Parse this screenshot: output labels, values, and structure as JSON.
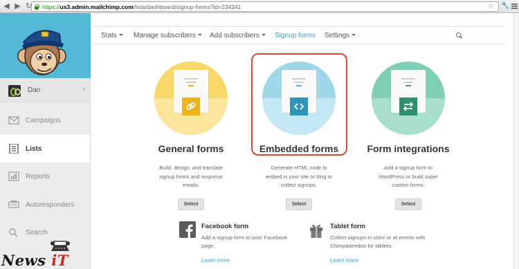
{
  "browser": {
    "url_scheme": "https://",
    "url_host": "us3.admin.mailchimp.com",
    "url_path": "/lists/dashboard/signup-forms?id=234341"
  },
  "sidebar": {
    "user_name": "Dan",
    "items": [
      {
        "label": "Campaigns",
        "icon": "envelope-icon",
        "active": false
      },
      {
        "label": "Lists",
        "icon": "list-icon",
        "active": true
      },
      {
        "label": "Reports",
        "icon": "bar-chart-icon",
        "active": false
      },
      {
        "label": "Autoresponders",
        "icon": "autoresponder-icon",
        "active": false
      },
      {
        "label": "Search",
        "icon": "search-icon",
        "active": false
      }
    ]
  },
  "topnav": {
    "items": [
      {
        "label": "Stats",
        "dropdown": true
      },
      {
        "label": "Manage subscribers",
        "dropdown": true
      },
      {
        "label": "Add subscribers",
        "dropdown": true
      },
      {
        "label": "Signup forms",
        "dropdown": false,
        "selected": true
      },
      {
        "label": "Settings",
        "dropdown": true
      }
    ]
  },
  "cards": [
    {
      "title": "General forms",
      "desc": [
        "Build, design, and translate",
        "signup forms and response",
        "emails."
      ],
      "button": "Select",
      "icon": "link-icon",
      "colors": {
        "top": "#f9d86a",
        "bottom": "#fbe59a",
        "badge": "#f0b21b",
        "accent": "#f0b21b"
      }
    },
    {
      "title": "Embedded forms",
      "desc": [
        "Generate HTML code to",
        "embed in your site or blog to",
        "collect signups."
      ],
      "button": "Select",
      "icon": "code-icon",
      "colors": {
        "top": "#9fd7e9",
        "bottom": "#c4e8f3",
        "badge": "#2d96b7",
        "accent": "#52bad5"
      }
    },
    {
      "title": "Form integrations",
      "desc": [
        "Add a signup form to",
        "WordPress or build super",
        "custom forms."
      ],
      "button": "Select",
      "icon": "arrows-swap-icon",
      "colors": {
        "top": "#7fcfb4",
        "bottom": "#a8dfcc",
        "badge": "#2d8f6f",
        "accent": "#3aa683"
      }
    }
  ],
  "extras": [
    {
      "title": "Facebook form",
      "desc": "Add a signup form to your Facebook page.",
      "link": "Learn more",
      "icon": "facebook-icon"
    },
    {
      "title": "Tablet form",
      "desc": "Collect signups in store or at events with Chimpadeedoo for tablets.",
      "link": "Learn more",
      "icon": "gift-icon"
    }
  ],
  "watermark": {
    "text_main": "News ",
    "text_accent": "iT"
  },
  "colors": {
    "brand": "#52bad5",
    "link": "#3a9fbf",
    "highlight": "#d64b32"
  }
}
